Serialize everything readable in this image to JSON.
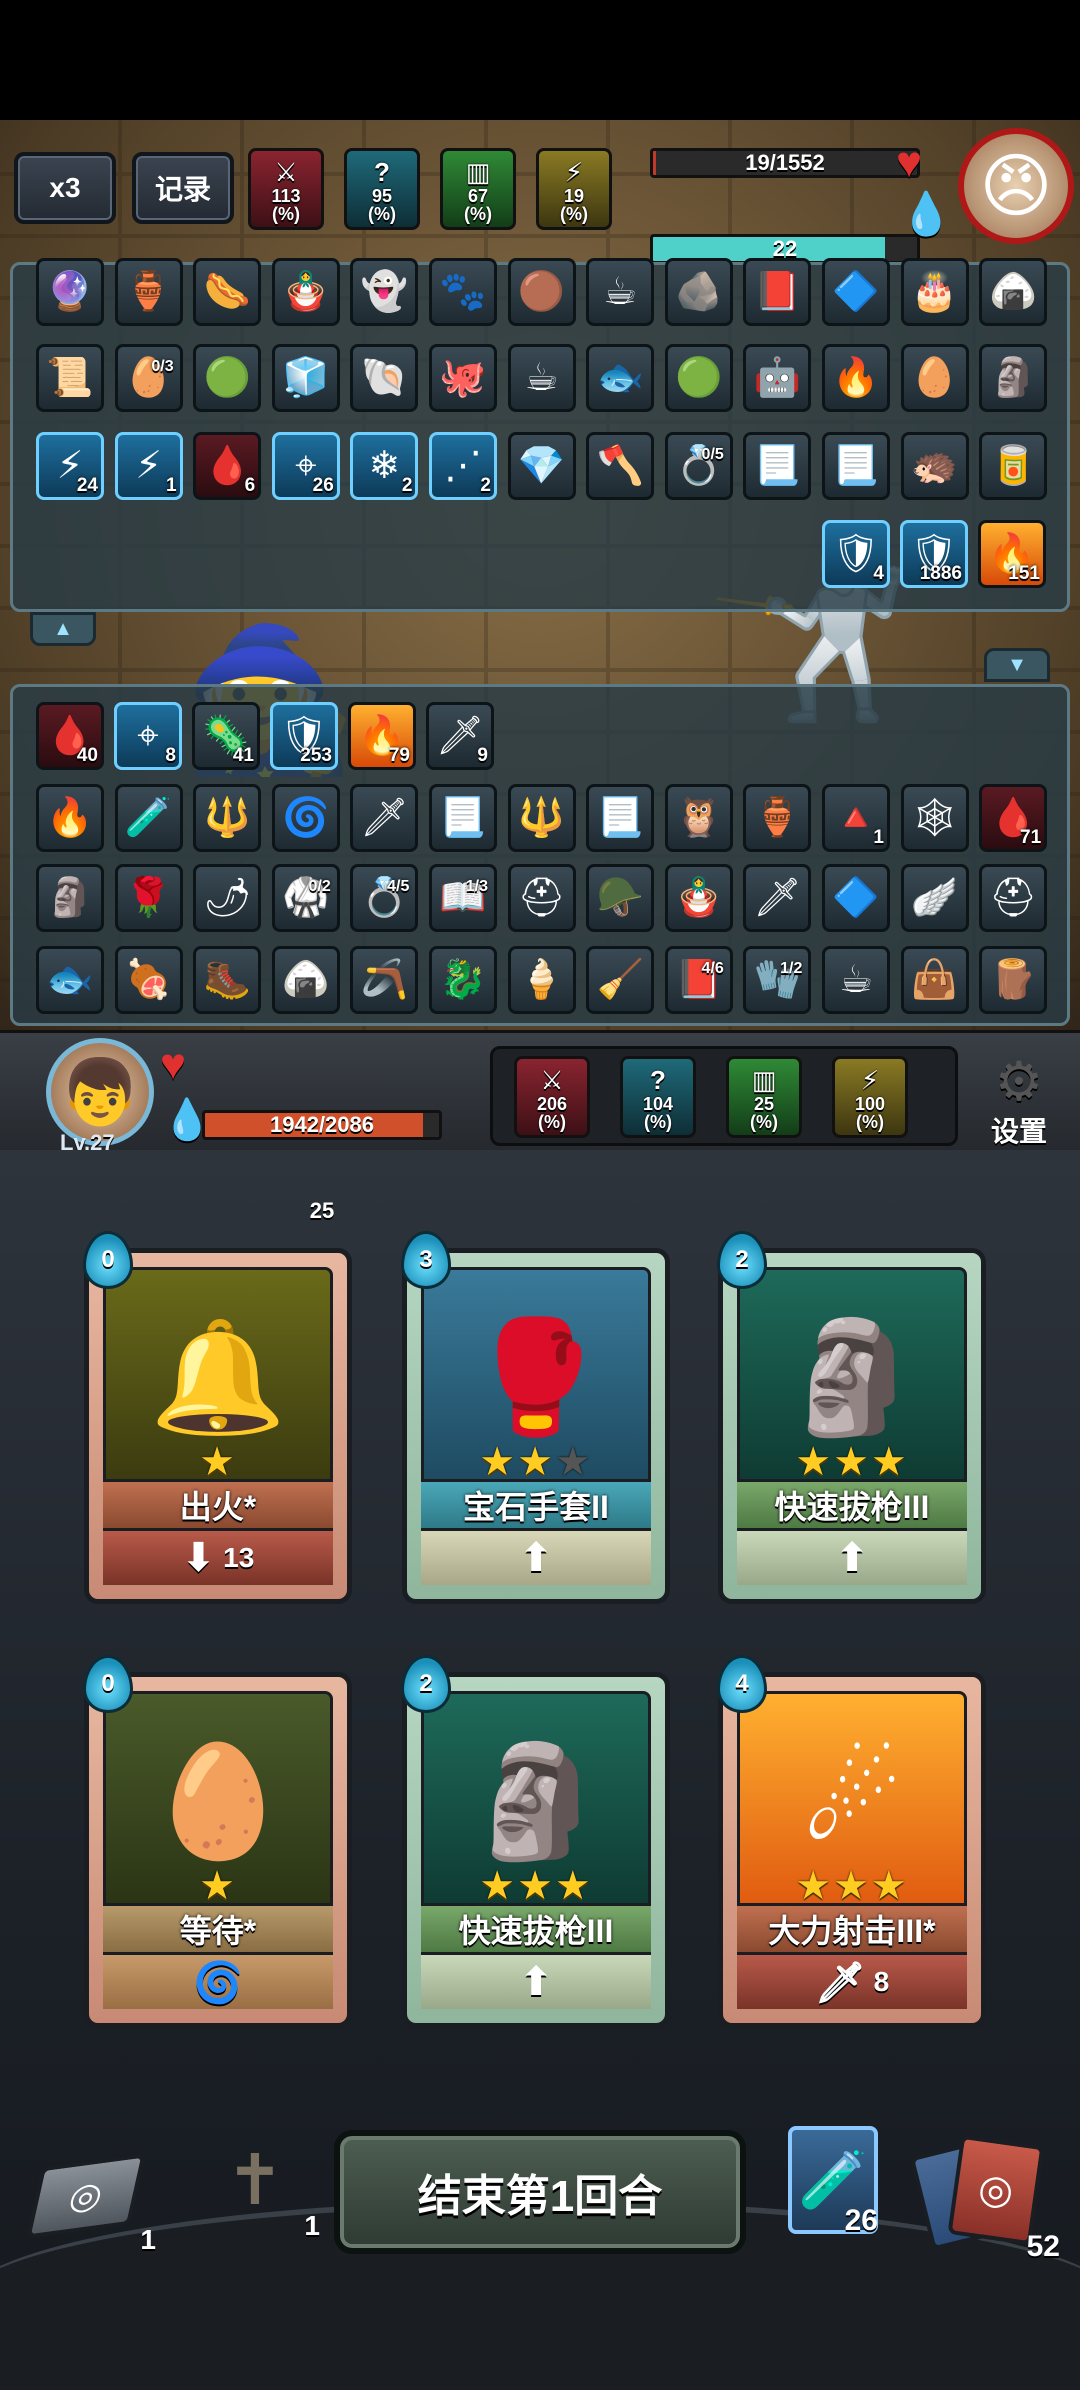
{
  "speed_label": "x3",
  "record_label": "记录",
  "enemy": {
    "stats": [
      {
        "icon": "sword-down-icon",
        "glyph": "⚔",
        "value": "113",
        "unit": "(%)",
        "cls": "s-atk"
      },
      {
        "icon": "question-icon",
        "glyph": "?",
        "value": "95",
        "unit": "(%)",
        "cls": "s-crit"
      },
      {
        "icon": "shield-bars-icon",
        "glyph": "▥",
        "value": "67",
        "unit": "(%)",
        "cls": "s-def"
      },
      {
        "icon": "boot-icon",
        "glyph": "⚡",
        "value": "19",
        "unit": "(%)",
        "cls": "s-spd"
      }
    ],
    "hp_text": "19/1552",
    "hp_fraction": 0.012,
    "mana_text": "22",
    "mana_fraction": 0.88
  },
  "enemy_items": {
    "row1": [
      "🔮",
      "🏺",
      "🌭",
      "🪆",
      "👻",
      "🐾",
      "🟤",
      "☕",
      "🪨",
      "📕",
      "🔷",
      "🎂",
      "🍙"
    ],
    "row2": [
      {
        "g": "📜"
      },
      {
        "g": "🥚",
        "frac": "0/3"
      },
      {
        "g": "🟢"
      },
      {
        "g": "🧊"
      },
      {
        "g": "🐚"
      },
      {
        "g": "🐙"
      },
      {
        "g": "☕"
      },
      {
        "g": "🐟"
      },
      {
        "g": "🟢"
      },
      {
        "g": "🤖"
      },
      {
        "g": "🔥"
      },
      {
        "g": "🥚"
      },
      {
        "g": "🗿"
      }
    ],
    "row3": [
      {
        "g": "⚡",
        "cnt": "24",
        "cls": "blue"
      },
      {
        "g": "⚡",
        "cnt": "1",
        "cls": "blue"
      },
      {
        "g": "🩸",
        "cnt": "6",
        "cls": "red"
      },
      {
        "g": "⌖",
        "cnt": "26",
        "cls": "blue"
      },
      {
        "g": "❄",
        "cnt": "2",
        "cls": "blue"
      },
      {
        "g": "⋰",
        "cnt": "2",
        "cls": "blue"
      },
      {
        "g": "💎"
      },
      {
        "g": "🪓"
      },
      {
        "g": "💍",
        "frac": "0/5"
      },
      {
        "g": "📃"
      },
      {
        "g": "📃"
      },
      {
        "g": "🦔"
      },
      {
        "g": "🥫"
      }
    ],
    "buffs": [
      {
        "g": "🛡",
        "cnt": "4",
        "cls": "blue"
      },
      {
        "g": "🛡",
        "cnt": "1886",
        "cls": "blue"
      },
      {
        "g": "🔥",
        "cnt": "151",
        "cls": "fire"
      }
    ]
  },
  "player_items": {
    "buffs": [
      {
        "g": "🩸",
        "cnt": "40",
        "cls": "red"
      },
      {
        "g": "⌖",
        "cnt": "8",
        "cls": "blue"
      },
      {
        "g": "🦠",
        "cnt": "41"
      },
      {
        "g": "🛡",
        "cnt": "253",
        "cls": "blue"
      },
      {
        "g": "🔥",
        "cnt": "79",
        "cls": "fire"
      },
      {
        "g": "🗡",
        "cnt": "9"
      }
    ],
    "row1": [
      {
        "g": "🔥"
      },
      {
        "g": "🧪"
      },
      {
        "g": "🔱"
      },
      {
        "g": "🌀"
      },
      {
        "g": "🗡"
      },
      {
        "g": "📃"
      },
      {
        "g": "🔱"
      },
      {
        "g": "📃"
      },
      {
        "g": "🦉"
      },
      {
        "g": "🏺"
      },
      {
        "g": "🔺",
        "cnt": "1"
      },
      {
        "g": "🕸"
      },
      {
        "g": "🩸",
        "cnt": "71",
        "cls": "red"
      }
    ],
    "row2": [
      {
        "g": "🗿"
      },
      {
        "g": "🌹"
      },
      {
        "g": "🌶"
      },
      {
        "g": "🥋",
        "frac": "0/2"
      },
      {
        "g": "💍",
        "frac": "4/5"
      },
      {
        "g": "📖",
        "frac": "1/3"
      },
      {
        "g": "⛑"
      },
      {
        "g": "🪖"
      },
      {
        "g": "🪆"
      },
      {
        "g": "🗡"
      },
      {
        "g": "🔷"
      },
      {
        "g": "🪽"
      },
      {
        "g": "⛑"
      }
    ],
    "row3": [
      {
        "g": "🐟"
      },
      {
        "g": "🍖"
      },
      {
        "g": "🥾"
      },
      {
        "g": "🍙"
      },
      {
        "g": "🪃"
      },
      {
        "g": "🐉"
      },
      {
        "g": "🍦"
      },
      {
        "g": "🧹"
      },
      {
        "g": "📕",
        "frac": "4/6"
      },
      {
        "g": "🧤",
        "frac": "1/2"
      },
      {
        "g": "☕"
      },
      {
        "g": "👜"
      },
      {
        "g": "🪵"
      }
    ]
  },
  "player": {
    "level": "Lv.27",
    "hp_text": "1942/2086",
    "hp_fraction": 0.93,
    "mana_text": "25",
    "mana_fraction": 1.0,
    "stats": [
      {
        "icon": "sword-down-icon",
        "glyph": "⚔",
        "value": "206",
        "unit": "(%)",
        "cls": "s-atk"
      },
      {
        "icon": "question-icon",
        "glyph": "?",
        "value": "104",
        "unit": "(%)",
        "cls": "s-crit"
      },
      {
        "icon": "shield-bars-icon",
        "glyph": "▥",
        "value": "25",
        "unit": "(%)",
        "cls": "s-def"
      },
      {
        "icon": "boot-icon",
        "glyph": "⚡",
        "value": "100",
        "unit": "(%)",
        "cls": "s-spd"
      }
    ]
  },
  "settings_label": "设置",
  "cards": [
    {
      "cost": "0",
      "name": "出火*",
      "stars": 1,
      "max_stars": 1,
      "style": "gold",
      "art": "🔔",
      "art_bg": "linear-gradient(#6a6a1a,#3a3a10)",
      "name_bg": "linear-gradient(#c07050,#8a4a30)",
      "foot_bg": "linear-gradient(#b85a4a,#7a3328)",
      "foot_icon": "⬇",
      "foot_value": "13"
    },
    {
      "cost": "3",
      "name": "宝石手套II",
      "stars": 2,
      "max_stars": 3,
      "style": "green",
      "art": "🥊",
      "art_bg": "linear-gradient(#3a7a9a,#1e4a60)",
      "name_bg": "linear-gradient(#4aa8b8,#2e7a88)",
      "foot_bg": "linear-gradient(#d8d8b8,#a8a888)",
      "foot_icon": "⬆",
      "foot_value": ""
    },
    {
      "cost": "2",
      "name": "快速拔枪III",
      "stars": 3,
      "max_stars": 3,
      "style": "green",
      "art": "🗿",
      "art_bg": "linear-gradient(#1e6a5a,#0e3a32)",
      "name_bg": "linear-gradient(#7aa86a,#4e7a44)",
      "foot_bg": "linear-gradient(#c8d8b8,#98a888)",
      "foot_icon": "⬆",
      "foot_value": ""
    },
    {
      "cost": "0",
      "name": "等待*",
      "stars": 1,
      "max_stars": 1,
      "style": "gold",
      "art": "🥚",
      "art_bg": "linear-gradient(#4a5a2a,#2a3414)",
      "name_bg": "linear-gradient(#b89a6a,#8a6e44)",
      "foot_bg": "linear-gradient(#c89a6a,#9a6e44)",
      "foot_icon": "🌀",
      "foot_value": ""
    },
    {
      "cost": "2",
      "name": "快速拔枪III",
      "stars": 3,
      "max_stars": 3,
      "style": "green",
      "art": "🗿",
      "art_bg": "linear-gradient(#1e6a5a,#0e3a32)",
      "name_bg": "linear-gradient(#7aa86a,#4e7a44)",
      "foot_bg": "linear-gradient(#c8d8b8,#98a888)",
      "foot_icon": "⬆",
      "foot_value": ""
    },
    {
      "cost": "4",
      "name": "大力射击III*",
      "stars": 3,
      "max_stars": 3,
      "style": "gold",
      "art": "☄",
      "art_bg": "linear-gradient(#ffb030,#e05a10)",
      "name_bg": "linear-gradient(#c07050,#8a4a30)",
      "foot_bg": "linear-gradient(#b85a4a,#7a3328)",
      "foot_icon": "🗡",
      "foot_value": "8"
    }
  ],
  "end_turn_label": "结束第1回合",
  "bottom": {
    "draw_pile_count": "1",
    "grave_count": "1",
    "potion_count": "26",
    "discard_count": "52"
  }
}
